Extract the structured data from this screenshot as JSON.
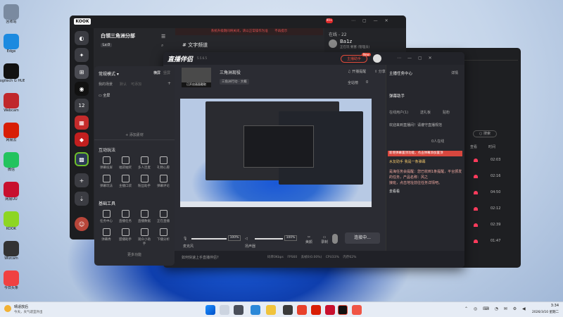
{
  "desktop": {
    "icons": [
      {
        "label": "回收站",
        "color": "#7a8aa0"
      },
      {
        "label": "Edge",
        "color": "#1c8ae0"
      },
      {
        "label": "Logitech G HUB",
        "color": "#111111"
      },
      {
        "label": "Webcam",
        "color": "#c0282c"
      },
      {
        "label": "网易云",
        "color": "#d81e06"
      },
      {
        "label": "微信",
        "color": "#22c35e"
      },
      {
        "label": "网易UU",
        "color": "#c8102e"
      },
      {
        "label": "KOOK",
        "color": "#8dd623"
      },
      {
        "label": "Wizcam",
        "color": "#333333"
      },
      {
        "label": "今日头条",
        "color": "#f04142"
      }
    ]
  },
  "kook": {
    "brand": "KOOK",
    "badge": "99+",
    "server_name": "白领三角洲分部",
    "level": "Lv.0",
    "channel": "文字频道",
    "notice": "系统升级期间将关闭，请以正常操作为准",
    "notice_link": "不再提示",
    "online": "在线 - 22",
    "user_name": "Ba1z",
    "user_status": "正在玩 要塞 (管理员)",
    "nav": [
      "12"
    ]
  },
  "zb": {
    "title": "直播伴侣",
    "version": "5.5.6.5",
    "live_btn": "主播助手",
    "badge": "New",
    "scene_mode": "常规模式",
    "horizontal": "横屏",
    "vertical": "竖屏",
    "my_scene": "我的场景",
    "scene_tabs": [
      "默认",
      "可添加"
    ],
    "scene_item": "全屏",
    "add_material": "+ 添加素材",
    "stream_title": "三角洲现役",
    "stream_sub": "三角洲行动 · 大概",
    "action1": "开播提醒",
    "action2": "分享",
    "stat1": "全站榜",
    "stat2": "0",
    "thumb_label": "已开启画面截取",
    "section1": "互动玩法",
    "tools1": [
      "弹幕投屏",
      "福袋抽奖",
      "多人连麦",
      "礼物心愿",
      "弹幕玩法",
      "主播口袋",
      "粉丝助手",
      "弹幕评论"
    ],
    "section2": "基础工具",
    "tools2": [
      "任务中心",
      "直播任务",
      "直播数据",
      "正在直播",
      "弹幕秀",
      "盟播助手",
      "观众小助手",
      "下播分析"
    ],
    "more": "更多功能",
    "mic": "麦克风",
    "mic_vol": "100%",
    "speaker": "扬声器",
    "spk_vol": "100%",
    "beauty": "美颜",
    "record": "录制",
    "start_btn": "连接中...",
    "status_tip": "如何快速上手直播伴侣?",
    "status_items": [
      "码率0Kbps",
      "FPS60",
      "丢帧0(0.00%)",
      "CPU33%",
      "内存62%"
    ]
  },
  "assist": {
    "title": "主播任务中心",
    "detail": "详情",
    "tabs": [
      "弹幕助手",
      "在线用户(1)",
      "送礼板",
      "贴粉"
    ],
    "lines": [
      "欢迎来到直播间！请遵守直播规范",
      "新增弹幕置顶功能，点击弹幕添加置顶",
      "水友助手 我是一条弹幕",
      "是海任务会提醒：您已收到1条提醒，平台颁发的任务，产品名称：风之",
      "接班，点击地址前往任务详情吧。",
      "去看看"
    ],
    "count_label": "0人在线",
    "rows": [
      "02:03",
      "02:16",
      "04:50",
      "02:12",
      "02:39",
      "01:47"
    ],
    "col1": "查看",
    "col2": "时间"
  },
  "taskbar": {
    "weather_title": "晴适放后",
    "weather_sub": "今天，天气适宜外出",
    "time": "3:34",
    "date": "2026/3/10 星期二"
  }
}
